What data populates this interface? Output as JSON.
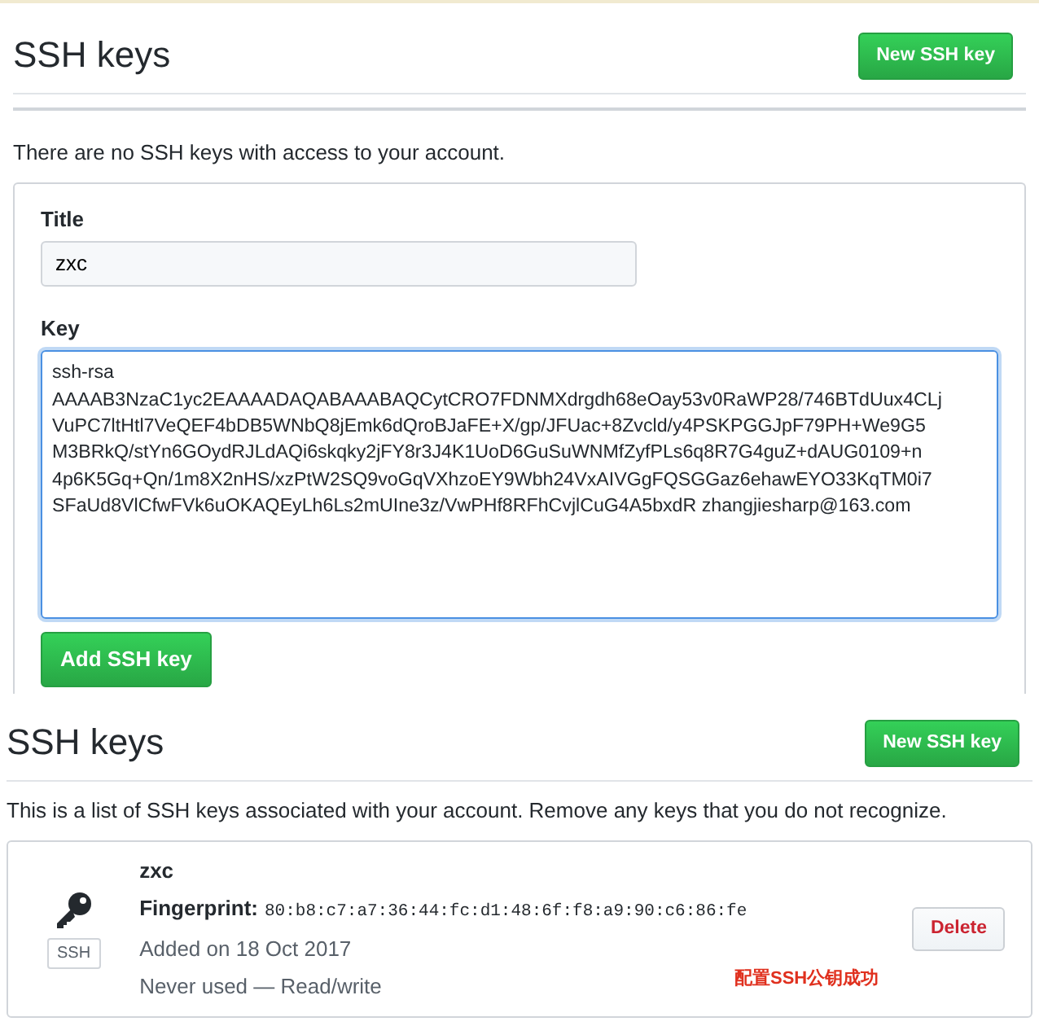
{
  "form_page": {
    "heading": "SSH keys",
    "new_button": "New SSH key",
    "empty_message": "There are no SSH keys with access to your account.",
    "title_label": "Title",
    "title_value": "zxc",
    "key_label": "Key",
    "key_lines": [
      "ssh-rsa",
      "AAAAB3NzaC1yc2EAAAADAQABAAABAQCytCRO7FDNMXdrgdh68eOay53v0RaWP28/746BTdUux4CLj",
      "VuPC7ltHtl7VeQEF4bDB5WNbQ8jEmk6dQroBJaFE+X/gp/JFUac+8Zvcld/y4PSKPGGJpF79PH+We9G5",
      "M3BRkQ/stYn6GOydRJLdAQi6skqky2jFY8r3J4K1UoD6GuSuWNMfZyfPLs6q8R7G4guZ+dAUG0109+n",
      "4p6K5Gq+Qn/1m8X2nHS/xzPtW2SQ9voGqVXhzoEY9Wbh24VxAIVGgFQSGGaz6ehawEYO33KqTM0i7",
      "SFaUd8VlCfwFVk6uOKAQEyLh6Ls2mUIne3z/VwPHf8RFhCvjlCuG4A5bxdR zhangjiesharp@163.com"
    ],
    "submit_button": "Add SSH key"
  },
  "list_page": {
    "heading": "SSH keys",
    "new_button": "New SSH key",
    "intro": "This is a list of SSH keys associated with your account. Remove any keys that you do not recognize.",
    "keys": [
      {
        "title": "zxc",
        "badge": "SSH",
        "fingerprint_label": "Fingerprint:",
        "fingerprint": "80:b8:c7:a7:36:44:fc:d1:48:6f:f8:a9:90:c6:86:fe",
        "added": "Added on 18 Oct 2017",
        "usage": "Never used — Read/write",
        "delete_button": "Delete"
      }
    ],
    "annotation": "配置SSH公钥成功"
  }
}
